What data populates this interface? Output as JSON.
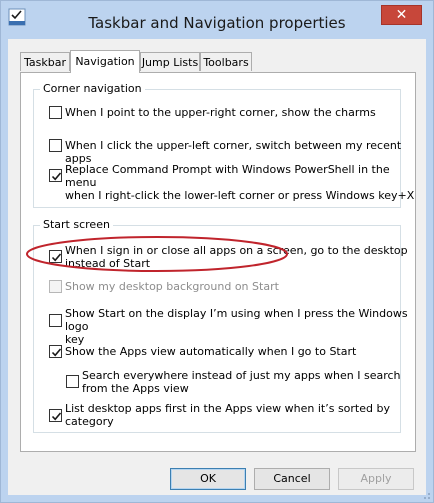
{
  "window": {
    "title": "Taskbar and Navigation properties",
    "close_symbol": "✕"
  },
  "tabs": [
    {
      "label": "Taskbar",
      "active": false
    },
    {
      "label": "Navigation",
      "active": true
    },
    {
      "label": "Jump Lists",
      "active": false
    },
    {
      "label": "Toolbars",
      "active": false
    }
  ],
  "corner_navigation": {
    "title": "Corner navigation",
    "options": [
      {
        "label": "When I point to the upper-right corner, show the charms",
        "checked": false,
        "enabled": true
      },
      {
        "label": "When I click the upper-left corner, switch between my recent apps",
        "checked": false,
        "enabled": true
      },
      {
        "label": "Replace Command Prompt with Windows PowerShell in the menu\nwhen I right-click the lower-left corner or press Windows key+X",
        "checked": true,
        "enabled": true
      }
    ]
  },
  "start_screen": {
    "title": "Start screen",
    "options": [
      {
        "label": "When I sign in or close all apps on a screen, go to the desktop\ninstead of Start",
        "checked": true,
        "enabled": true
      },
      {
        "label": "Show my desktop background on Start",
        "checked": false,
        "enabled": false
      },
      {
        "label": "Show Start on the display I’m using when I press the Windows logo\nkey",
        "checked": false,
        "enabled": true
      },
      {
        "label": "Show the Apps view automatically when I go to Start",
        "checked": true,
        "enabled": true
      },
      {
        "label": "Search everywhere instead of just my apps when I search\nfrom the Apps view",
        "checked": false,
        "enabled": true
      },
      {
        "label": "List desktop apps first in the Apps view when it’s sorted by\ncategory",
        "checked": true,
        "enabled": true
      }
    ]
  },
  "buttons": {
    "ok": "OK",
    "cancel": "Cancel",
    "apply": "Apply"
  },
  "colors": {
    "title_bar": "#bcd3ef",
    "close_button": "#c7473a",
    "highlight_ellipse": "#c0242c"
  }
}
